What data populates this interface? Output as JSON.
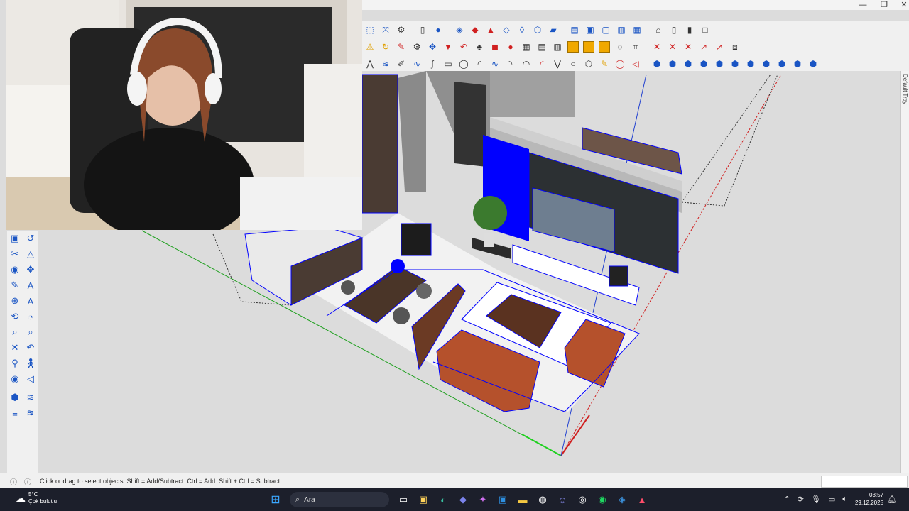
{
  "window": {
    "minimize_glyph": "—",
    "maximize_glyph": "❐",
    "close_glyph": "✕"
  },
  "toolbars": {
    "row1": [
      "select-icon",
      "orbit-icon",
      "gear-icon",
      "document-icon",
      "user-icon",
      "pencil-stack-icon",
      "paint-icon",
      "push-pull-icon",
      "cube-icon",
      "shape-icon",
      "hexagon-icon",
      "plane-icon",
      "layers-icon",
      "frame-icon",
      "box-icon",
      "stack-icon",
      "panel-icon",
      "house-icon",
      "column-icon",
      "door-icon",
      "square-icon"
    ],
    "row2": [
      "warning-icon",
      "rotate-icon",
      "brush-icon",
      "move-icon",
      "bucket-icon",
      "undo-icon",
      "tree-icon",
      "gear-icon",
      "cube-icon",
      "sphere-icon",
      "grid-icon",
      "table-icon",
      "grid-icon",
      "orange-square-icon",
      "orange-square-icon",
      "orange-square-icon",
      "globe-icon",
      "tape-icon",
      "cross-icon",
      "cross-icon",
      "cross-icon",
      "arrow-icon",
      "arrow-icon",
      "box-icon"
    ],
    "row3": [
      "line-icon",
      "wave-icon",
      "pen-icon",
      "wave-icon",
      "curve-icon",
      "rectangle-icon",
      "circle-icon",
      "arc-icon",
      "spline-icon",
      "arc-icon",
      "arc-icon",
      "zigzag-icon",
      "curve-icon",
      "circle-icon",
      "wrench-icon",
      "circle-icon",
      "arrow-icon",
      "cube-icon",
      "cube-icon",
      "cube-icon",
      "cube-icon",
      "cube-icon",
      "cube-icon",
      "cube-icon",
      "cube-icon",
      "cube-icon",
      "cube-icon",
      "cube-icon",
      "cube-icon"
    ]
  },
  "tray": {
    "label": "Default Tray"
  },
  "status": {
    "message": "Click or drag to select objects. Shift = Add/Subtract. Ctrl = Add. Shift + Ctrl = Subtract."
  },
  "taskbar": {
    "weather_temp": "5°C",
    "weather_desc": "Çok bulutlu",
    "search_label": "Ara",
    "time": "03:57",
    "date": "29.12.2025",
    "apps": [
      "start-icon",
      "search",
      "task-view-icon",
      "store-icon",
      "edge-icon",
      "teams-icon",
      "copilot-icon",
      "outlook-icon",
      "folder-icon",
      "steam-icon",
      "discord-icon",
      "obs-icon",
      "spotify-icon",
      "sketchup-icon",
      "app-icon"
    ]
  },
  "colors": {
    "accent": "#1a55c4",
    "selection": "#0000ff",
    "axis_green": "#20a020",
    "axis_red": "#d02020",
    "sofa": "#b5512c"
  }
}
